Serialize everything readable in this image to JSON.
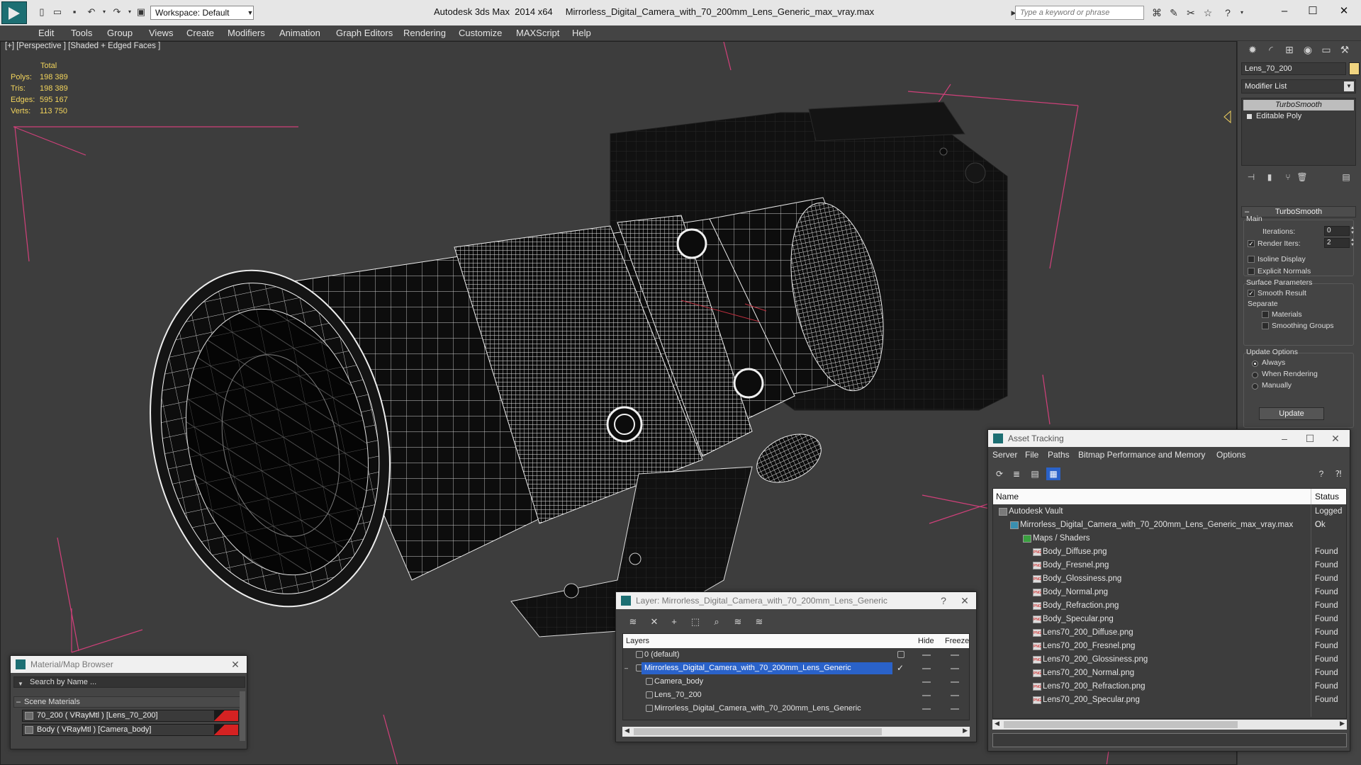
{
  "titlebar": {
    "workspace": "Workspace: Default",
    "title": "Autodesk 3ds Max  2014 x64     Mirrorless_Digital_Camera_with_70_200mm_Lens_Generic_max_vray.max",
    "search_placeholder": "Type a keyword or phrase"
  },
  "menu": [
    "Edit",
    "Tools",
    "Group",
    "Views",
    "Create",
    "Modifiers",
    "Animation",
    "Graph Editors",
    "Rendering",
    "Customize",
    "MAXScript",
    "Help"
  ],
  "viewport": {
    "label": "[+] [Perspective ] [Shaded + Edged Faces ]",
    "stats_header": "Total",
    "stats": [
      {
        "k": "Polys:",
        "v": "198 389"
      },
      {
        "k": "Tris:",
        "v": "198 389"
      },
      {
        "k": "Edges:",
        "v": "595 167"
      },
      {
        "k": "Verts:",
        "v": "113 750"
      }
    ]
  },
  "command_panel": {
    "object_name": "Lens_70_200",
    "modifier_list": "Modifier List",
    "stack": [
      "TurboSmooth",
      "Editable Poly"
    ],
    "rollout_title": "TurboSmooth",
    "main_label": "Main",
    "iterations_label": "Iterations:",
    "iterations_value": "0",
    "render_iters_label": "Render Iters:",
    "render_iters_value": "2",
    "isoline_label": "Isoline Display",
    "explicit_label": "Explicit Normals",
    "surface_label": "Surface Parameters",
    "smooth_result_label": "Smooth Result",
    "separate_label": "Separate",
    "materials_label": "Materials",
    "smoothing_groups_label": "Smoothing Groups",
    "update_options_label": "Update Options",
    "always_label": "Always",
    "when_rendering_label": "When Rendering",
    "manually_label": "Manually",
    "update_button": "Update"
  },
  "material_browser": {
    "title": "Material/Map Browser",
    "search_placeholder": "Search by Name ...",
    "group": "Scene Materials",
    "items": [
      "70_200  ( VRayMtl ) [Lens_70_200]",
      "Body  ( VRayMtl ) [Camera_body]"
    ]
  },
  "layers": {
    "title": "Layer: Mirrorless_Digital_Camera_with_70_200mm_Lens_Generic",
    "col_layers": "Layers",
    "col_hide": "Hide",
    "col_freeze": "Freeze",
    "rows": [
      "0 (default)",
      "Mirrorless_Digital_Camera_with_70_200mm_Lens_Generic",
      "Camera_body",
      "Lens_70_200",
      "Mirrorless_Digital_Camera_with_70_200mm_Lens_Generic"
    ]
  },
  "asset_tracking": {
    "title": "Asset Tracking",
    "menu": [
      "Server",
      "File",
      "Paths",
      "Bitmap Performance and Memory",
      "Options"
    ],
    "col_name": "Name",
    "col_status": "Status",
    "rows": [
      {
        "name": "Autodesk Vault",
        "status": "Logged O"
      },
      {
        "name": "Mirrorless_Digital_Camera_with_70_200mm_Lens_Generic_max_vray.max",
        "status": "Ok"
      },
      {
        "name": "Maps / Shaders",
        "status": ""
      },
      {
        "name": "Body_Diffuse.png",
        "status": "Found"
      },
      {
        "name": "Body_Fresnel.png",
        "status": "Found"
      },
      {
        "name": "Body_Glossiness.png",
        "status": "Found"
      },
      {
        "name": "Body_Normal.png",
        "status": "Found"
      },
      {
        "name": "Body_Refraction.png",
        "status": "Found"
      },
      {
        "name": "Body_Specular.png",
        "status": "Found"
      },
      {
        "name": "Lens70_200_Diffuse.png",
        "status": "Found"
      },
      {
        "name": "Lens70_200_Fresnel.png",
        "status": "Found"
      },
      {
        "name": "Lens70_200_Glossiness.png",
        "status": "Found"
      },
      {
        "name": "Lens70_200_Normal.png",
        "status": "Found"
      },
      {
        "name": "Lens70_200_Refraction.png",
        "status": "Found"
      },
      {
        "name": "Lens70_200_Specular.png",
        "status": "Found"
      }
    ]
  },
  "colors": {
    "stats_text": "#f2d45c",
    "selection_blue": "#2a62c9",
    "grid_line": "#d0407a",
    "material_swatch": "#d52222"
  }
}
